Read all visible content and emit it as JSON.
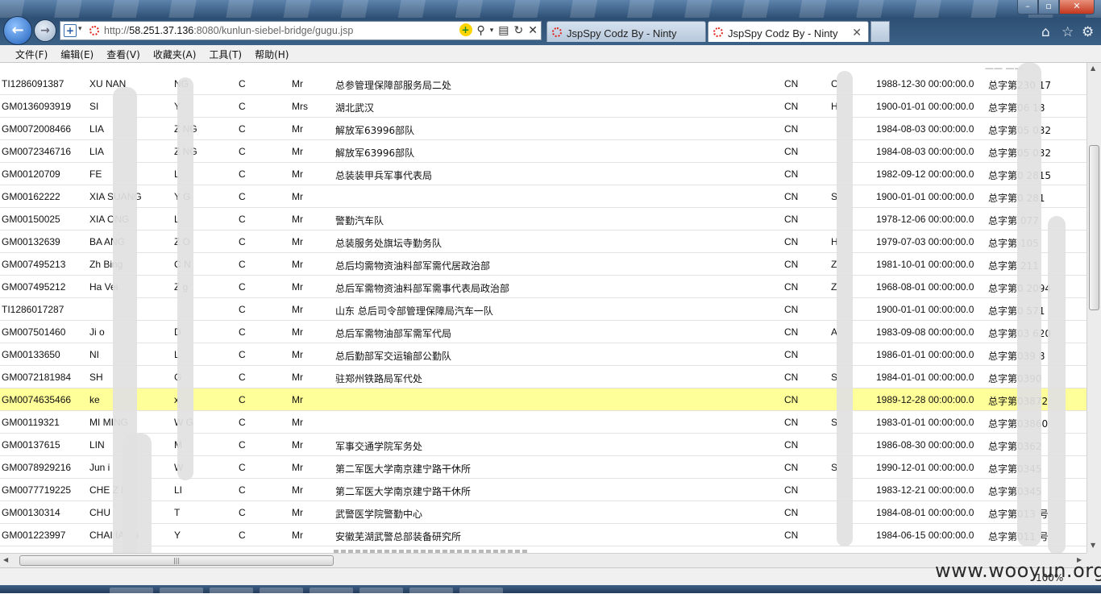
{
  "browser": {
    "url_prefix": "http://",
    "url_host": "58.251.37.136",
    "url_rest": ":8080/kunlun-siebel-bridge/gugu.jsp",
    "tabs": [
      {
        "title": "JspSpy Codz By - Ninty",
        "active": false
      },
      {
        "title": "JspSpy Codz By - Ninty",
        "active": true
      }
    ],
    "close_tab_glyph": "✕",
    "window_buttons": {
      "minimize": "–",
      "maximize": "▫",
      "close": "✕"
    }
  },
  "menu": [
    "文件(F)",
    "编辑(E)",
    "查看(V)",
    "收藏夹(A)",
    "工具(T)",
    "帮助(H)"
  ],
  "table": {
    "top_partial": "—— ——",
    "rows": [
      [
        "TI1286091387",
        "XU NAN",
        "NG",
        "C",
        "Mr",
        "总参管理保障部服务局二处",
        "CN",
        "C",
        "1988-12-30 00:00:00.0",
        "总字第230 17"
      ],
      [
        "GM0136093919",
        "SI",
        "Y",
        "C",
        "Mrs",
        "湖北武汉",
        "CN",
        "H",
        "1900-01-01 00:00:00.0",
        "总字第06 18"
      ],
      [
        "GM0072008466",
        "LIA",
        "Z NG",
        "C",
        "Mr",
        "解放军63996部队",
        "CN",
        "",
        "1984-08-03 00:00:00.0",
        "总字第05 032"
      ],
      [
        "GM0072346716",
        "LIA",
        "Z NG",
        "C",
        "Mr",
        "解放军63996部队",
        "CN",
        "",
        "1984-08-03 00:00:00.0",
        "总字第05 032"
      ],
      [
        "GM00120709",
        "FE",
        "L",
        "C",
        "Mr",
        "总装装甲兵军事代表局",
        "CN",
        "",
        "1982-09-12 00:00:00.0",
        "总字第0 2815"
      ],
      [
        "GM00162222",
        "XIA SUANG",
        "Y G",
        "C",
        "Mr",
        "",
        "CN",
        "S",
        "1900-01-01 00:00:00.0",
        "总字第0 281"
      ],
      [
        "GM00150025",
        "XIA ONG",
        "L",
        "C",
        "Mr",
        "警勤汽车队",
        "CN",
        "",
        "1978-12-06 00:00:00.0",
        "总字第 077"
      ],
      [
        "GM00132639",
        "BA ANG",
        "Z O",
        "C",
        "Mr",
        "总装服务处旗坛寺勤务队",
        "CN",
        "H",
        "1979-07-03 00:00:00.0",
        "总字第 105"
      ],
      [
        "GM007495213",
        "Zh Bing",
        "C N",
        "C",
        "Mr",
        "总后均需物资油料部军需代居政治部",
        "CN",
        "Z",
        "1981-10-01 00:00:00.0",
        "总字第 211"
      ],
      [
        "GM007495212",
        "Ha Vei",
        "Z g",
        "C",
        "Mr",
        "总后军需物资油料部军需事代表局政治部",
        "CN",
        "Z",
        "1968-08-01 00:00:00.0",
        "总字第0 2094"
      ],
      [
        "TI1286017287",
        "",
        "",
        "C",
        "Mr",
        "山东  总后司令部管理保障局汽车一队",
        "CN",
        "",
        "1900-01-01 00:00:00.0",
        "总字第0 571"
      ],
      [
        "GM007501460",
        "Ji o",
        "D",
        "C",
        "Mr",
        "总后军需物油部军需军代局",
        "CN",
        "A",
        "1983-09-08 00:00:00.0",
        "总字第03 620"
      ],
      [
        "GM00133650",
        "NI",
        "L",
        "C",
        "Mr",
        "总后勤部军交运输部公勤队",
        "CN",
        "",
        "1986-01-01 00:00:00.0",
        "总字第039 8"
      ],
      [
        "GM0072181984",
        "SH",
        "G",
        "C",
        "Mr",
        "驻郑州铁路局军代处",
        "CN",
        "S",
        "1984-01-01 00:00:00.0",
        "总字第0390"
      ],
      [
        "GM0074635466",
        "ke",
        "x",
        "C",
        "Mr",
        "",
        "CN",
        "",
        "1989-12-28 00:00:00.0",
        "总字第03872"
      ],
      [
        "GM00119321",
        "MI MING",
        "W G",
        "C",
        "Mr",
        "",
        "CN",
        "S",
        "1983-01-01 00:00:00.0",
        "总字第03860"
      ],
      [
        "GM00137615",
        "LIN",
        "M",
        "C",
        "Mr",
        "军事交通学院军务处",
        "CN",
        "",
        "1986-08-30 00:00:00.0",
        "总字第0362"
      ],
      [
        "GM0078929216",
        "Jun i",
        "W",
        "C",
        "Mr",
        "第二军医大学南京建宁路干休所",
        "CN",
        "S",
        "1990-12-01 00:00:00.0",
        "总字第0345"
      ],
      [
        "GM0077719225",
        "CHE Z NG",
        "LI",
        "C",
        "Mr",
        "第二军医大学南京建宁路干休所",
        "CN",
        "",
        "1983-12-21 00:00:00.0",
        "总字第0345"
      ],
      [
        "GM00130314",
        "CHU",
        "T",
        "C",
        "Mr",
        "武警医学院警勤中心",
        "CN",
        "",
        "1984-08-01 00:00:00.0",
        "总字第013 号"
      ],
      [
        "GM001223997",
        "CHAI IANG",
        "Y",
        "C",
        "Mr",
        "安徽芜湖武警总部装备研究所",
        "CN",
        "",
        "1984-06-15 00:00:00.0",
        "总字第011 号"
      ]
    ],
    "highlight_row": 14
  },
  "status": {
    "zoom": "100%"
  },
  "watermark": "www.wooyun.org",
  "colors": {
    "highlight": "#ffff99",
    "chrome": "#2e4f74"
  }
}
